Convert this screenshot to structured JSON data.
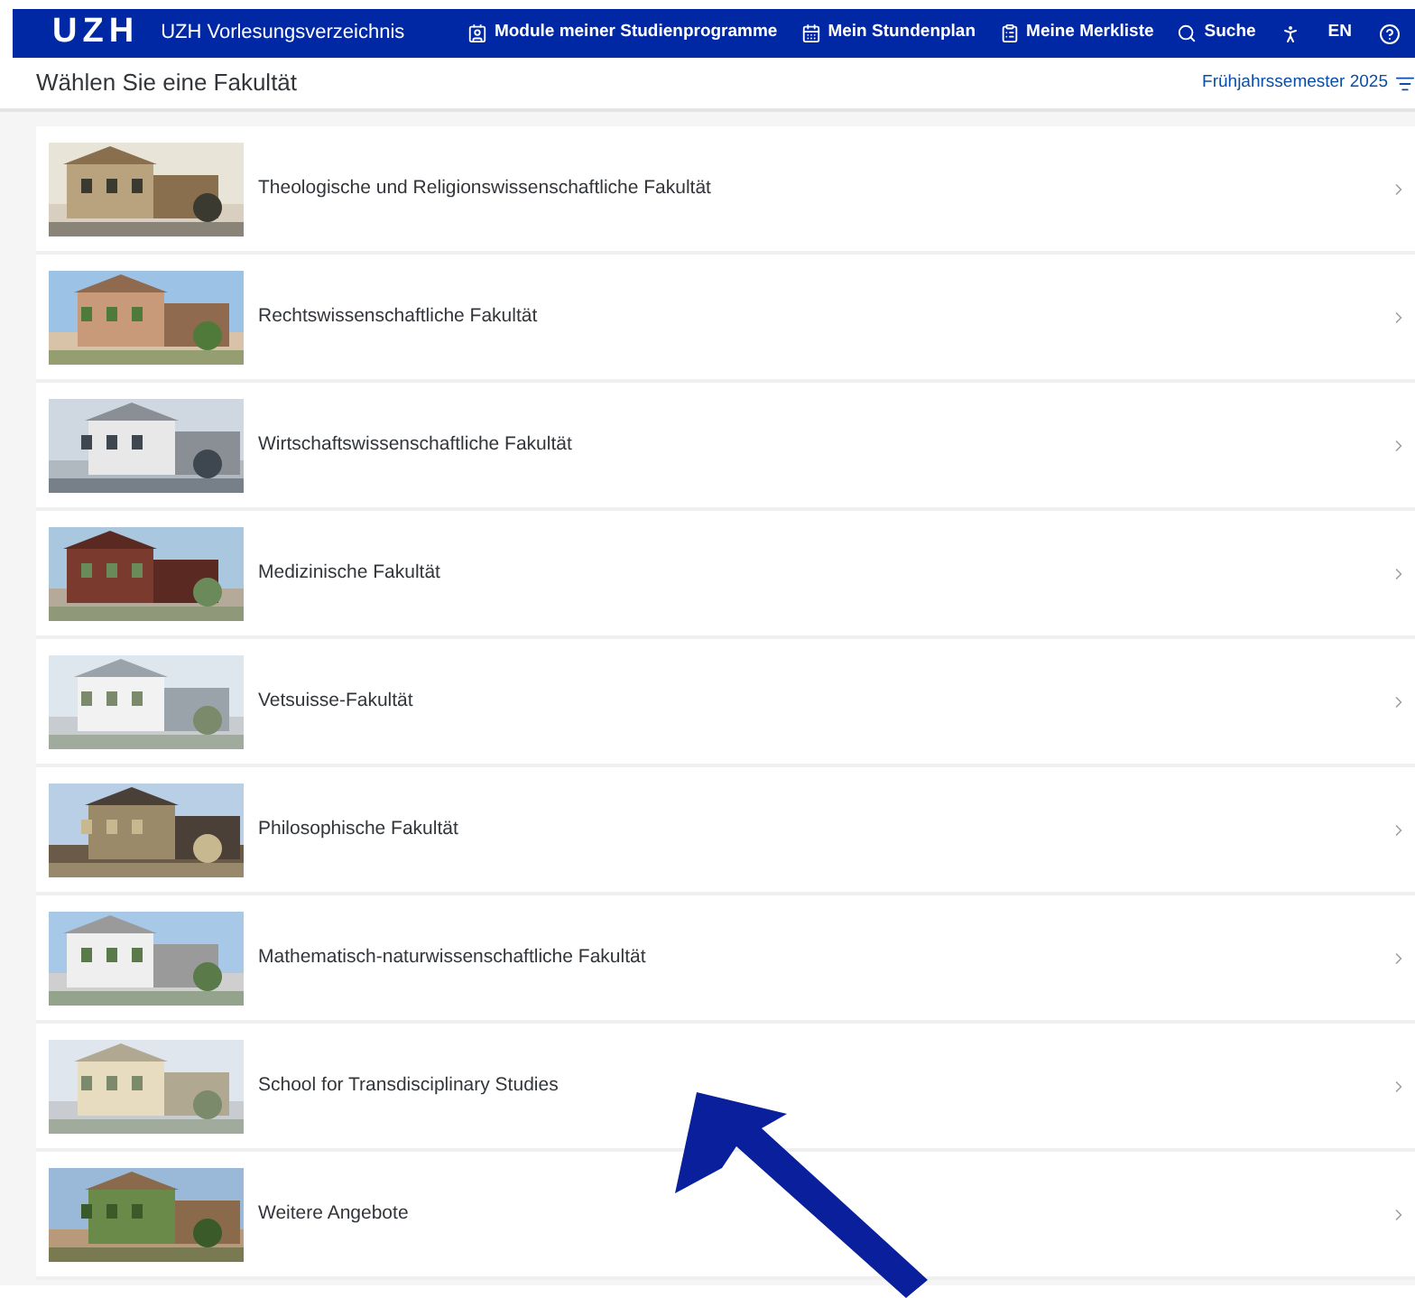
{
  "top_bar": {
    "logo": "UZH",
    "title": "UZH Vorlesungsverzeichnis",
    "nav": [
      {
        "kind": "modules",
        "label": "Module meiner Studienprogramme"
      },
      {
        "kind": "schedule",
        "label": "Mein Stundenplan"
      },
      {
        "kind": "watchlist",
        "label": "Meine Merkliste"
      },
      {
        "kind": "search",
        "label": "Suche"
      },
      {
        "kind": "accessibility"
      },
      {
        "kind": "text",
        "label": "EN"
      },
      {
        "kind": "help"
      }
    ]
  },
  "header": {
    "title": "Wählen Sie eine Fakultät",
    "semester": "Frühjahrssemester 2025"
  },
  "faculties": [
    {
      "name": "Theologische und Religionswissenschaftliche Fakultät"
    },
    {
      "name": "Rechtswissenschaftliche Fakultät"
    },
    {
      "name": "Wirtschaftswissenschaftliche Fakultät"
    },
    {
      "name": "Medizinische Fakultät"
    },
    {
      "name": "Vetsuisse-Fakultät"
    },
    {
      "name": "Philosophische Fakultät"
    },
    {
      "name": "Mathematisch-naturwissenschaftliche Fakultät"
    },
    {
      "name": "School for Transdisciplinary Studies"
    },
    {
      "name": "Weitere Angebote"
    }
  ]
}
